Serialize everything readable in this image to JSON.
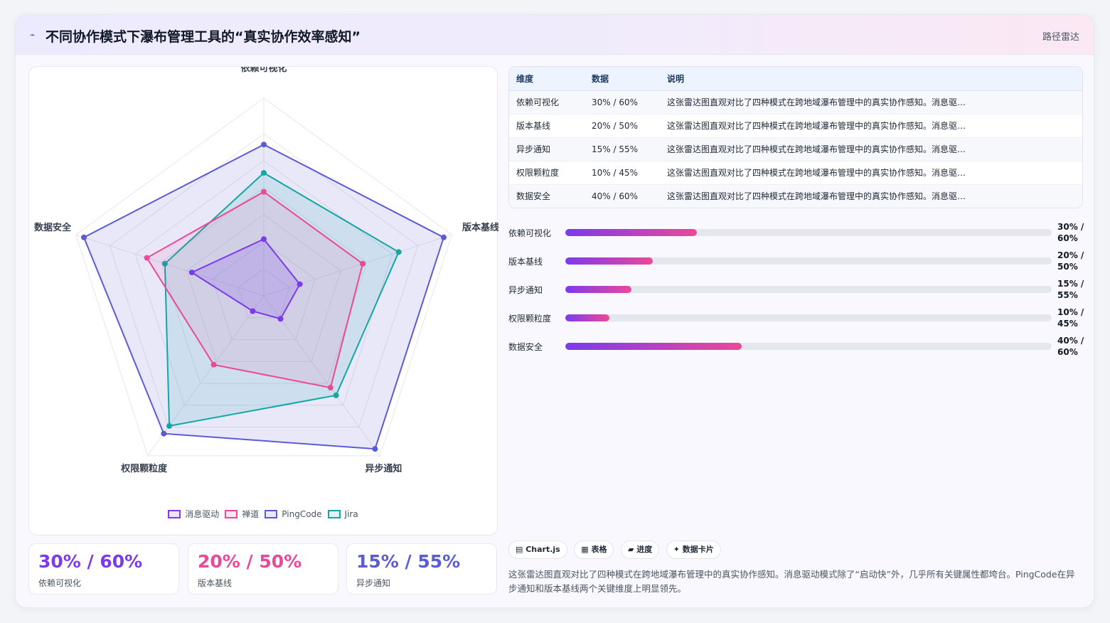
{
  "header": {
    "title": "不同协作模式下瀑布管理工具的“真实协作效率感知”",
    "tag": "路径雷达",
    "icon": "pulse-icon"
  },
  "chart_data": {
    "type": "radar",
    "axes": [
      "依赖可视化",
      "版本基线",
      "异步通知",
      "权限颗粒度",
      "数据安全"
    ],
    "range": [
      0,
      100
    ],
    "grid": true,
    "legend_position": "bottom",
    "series": [
      {
        "name": "消息驱动",
        "values": [
          30,
          20,
          15,
          10,
          40
        ],
        "color": "#7c3aed"
      },
      {
        "name": "禅道",
        "values": [
          55,
          55,
          60,
          45,
          65
        ],
        "color": "#ec4899"
      },
      {
        "name": "PingCode",
        "values": [
          80,
          100,
          100,
          90,
          100
        ],
        "color": "#5b5bd6"
      },
      {
        "name": "Jira",
        "values": [
          65,
          75,
          65,
          85,
          55
        ],
        "color": "#14a6a3"
      }
    ]
  },
  "stats": [
    {
      "value": "30% / 60%",
      "label": "依赖可视化",
      "color": "#7c3aed"
    },
    {
      "value": "20% / 50%",
      "label": "版本基线",
      "color": "#ec4899"
    },
    {
      "value": "15% / 55%",
      "label": "异步通知",
      "color": "#5b5bd6"
    }
  ],
  "table": {
    "headers": [
      "维度",
      "数据",
      "说明"
    ],
    "rows": [
      [
        "依赖可视化",
        "30% / 60%",
        "这张雷达图直观对比了四种模式在跨地域瀑布管理中的真实协作感知。消息驱…"
      ],
      [
        "版本基线",
        "20% / 50%",
        "这张雷达图直观对比了四种模式在跨地域瀑布管理中的真实协作感知。消息驱…"
      ],
      [
        "异步通知",
        "15% / 55%",
        "这张雷达图直观对比了四种模式在跨地域瀑布管理中的真实协作感知。消息驱…"
      ],
      [
        "权限颗粒度",
        "10% / 45%",
        "这张雷达图直观对比了四种模式在跨地域瀑布管理中的真实协作感知。消息驱…"
      ],
      [
        "数据安全",
        "40% / 60%",
        "这张雷达图直观对比了四种模式在跨地域瀑布管理中的真实协作感知。消息驱…"
      ]
    ]
  },
  "progress": [
    {
      "label": "依赖可视化",
      "value_line1": "30% /",
      "value_line2": "60%",
      "fill": 0.27
    },
    {
      "label": "版本基线",
      "value_line1": "20% /",
      "value_line2": "50%",
      "fill": 0.18
    },
    {
      "label": "异步通知",
      "value_line1": "15% /",
      "value_line2": "55%",
      "fill": 0.136
    },
    {
      "label": "权限颗粒度",
      "value_line1": "10% /",
      "value_line2": "45%",
      "fill": 0.09
    },
    {
      "label": "数据安全",
      "value_line1": "40% /",
      "value_line2": "60%",
      "fill": 0.363
    }
  ],
  "chips": [
    "▤ Chart.js",
    "▦ 表格",
    "▰ 进度",
    "✦ 数据卡片"
  ],
  "summary": "这张雷达图直观对比了四种模式在跨地域瀑布管理中的真实协作感知。消息驱动模式除了“启动快”外，几乎所有关键属性都垮台。PingCode在异步通知和版本基线两个关键维度上明显领先。"
}
